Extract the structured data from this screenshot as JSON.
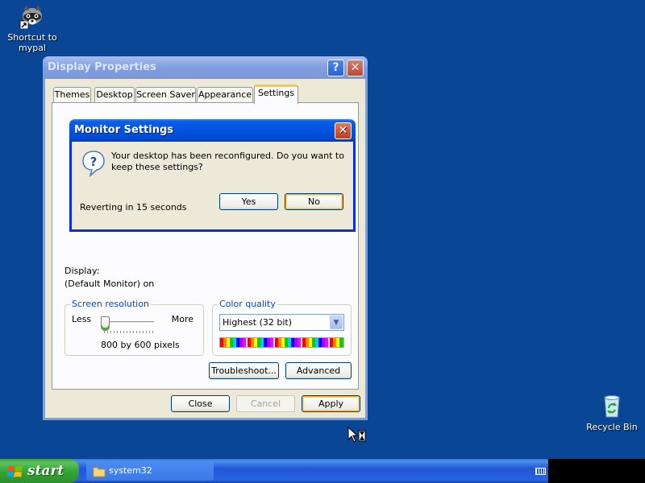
{
  "desktop": {
    "icons": [
      {
        "label_line1": "Shortcut to",
        "label_line2": "mypal",
        "icon": "raccoon-icon"
      },
      {
        "label": "Recycle Bin",
        "icon": "recycle-bin-icon"
      }
    ]
  },
  "display_properties": {
    "title": "Display Properties",
    "tabs": [
      "Themes",
      "Desktop",
      "Screen Saver",
      "Appearance",
      "Settings"
    ],
    "active_tab": "Settings",
    "display_label": "Display:",
    "display_value": "(Default Monitor) on",
    "screen_resolution": {
      "legend": "Screen resolution",
      "less": "Less",
      "more": "More",
      "value_text": "800 by 600 pixels",
      "slider_position": 0
    },
    "color_quality": {
      "legend": "Color quality",
      "selected": "Highest (32 bit)"
    },
    "buttons": {
      "troubleshoot": "Troubleshoot...",
      "advanced": "Advanced",
      "close": "Close",
      "cancel": "Cancel",
      "apply": "Apply"
    }
  },
  "monitor_settings": {
    "title": "Monitor Settings",
    "message": "Your desktop has been reconfigured.  Do you want to keep these settings?",
    "countdown": "Reverting in 15 seconds",
    "yes": "Yes",
    "no": "No"
  },
  "taskbar": {
    "start_label": "start",
    "tasks": [
      {
        "label": "system32",
        "icon": "folder-icon"
      }
    ]
  },
  "colors": {
    "desktop": "#0a4696",
    "title_active": "#0054e3",
    "window_bg": "#ece9d8"
  }
}
